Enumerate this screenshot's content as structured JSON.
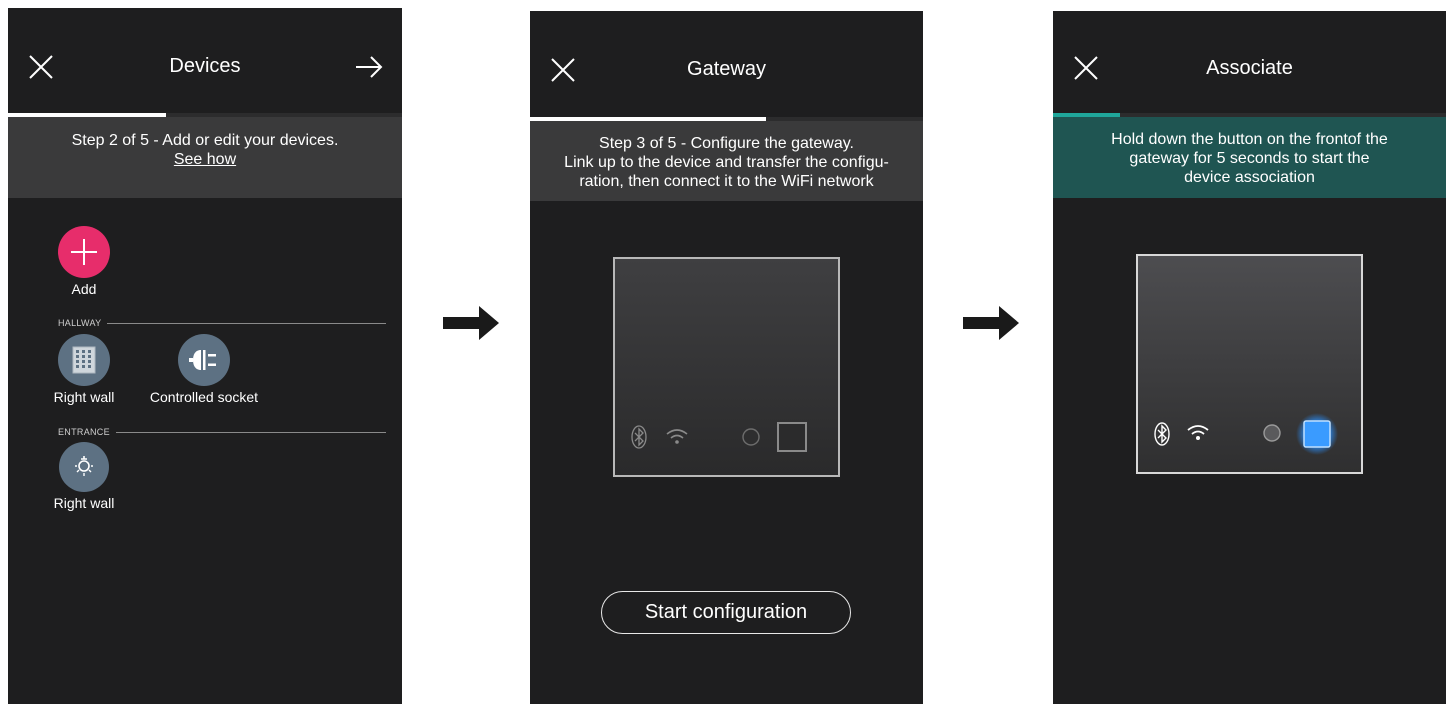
{
  "screens": {
    "devices": {
      "title": "Devices",
      "info": "Step 2 of 5 - Add or edit your devices.",
      "see_how": "See how",
      "add_label": "Add",
      "sections": [
        {
          "name": "HALLWAY",
          "devices": [
            {
              "label": "Right wall",
              "icon": "building-icon"
            },
            {
              "label": "Controlled socket",
              "icon": "socket-icon"
            }
          ]
        },
        {
          "name": "ENTRANCE",
          "devices": [
            {
              "label": "Right wall",
              "icon": "lamp-icon"
            }
          ]
        }
      ],
      "progress": 0.4
    },
    "gateway": {
      "title": "Gateway",
      "info_line1": "Step 3 of 5 - Configure the gateway.",
      "info_line2": "Link up to the device and transfer the configu-",
      "info_line3": "ration, then connect it to the WiFi network",
      "button": "Start configuration",
      "progress": 0.6
    },
    "associate": {
      "title": "Associate",
      "info_line1": "Hold down the button on the frontof the",
      "info_line2": "gateway for 5 seconds to start the",
      "info_line3": "device association",
      "progress": 0.17
    }
  },
  "colors": {
    "screen_bg": "#1e1e1f",
    "info_band": "#3a3a3b",
    "associate_band": "#1f5552",
    "progress": "#ffffff",
    "associate_progress": "#1fa79b",
    "add_button": "#e72d6b",
    "device_circle": "#5d7183",
    "highlight_blue": "#2a8cf5"
  }
}
